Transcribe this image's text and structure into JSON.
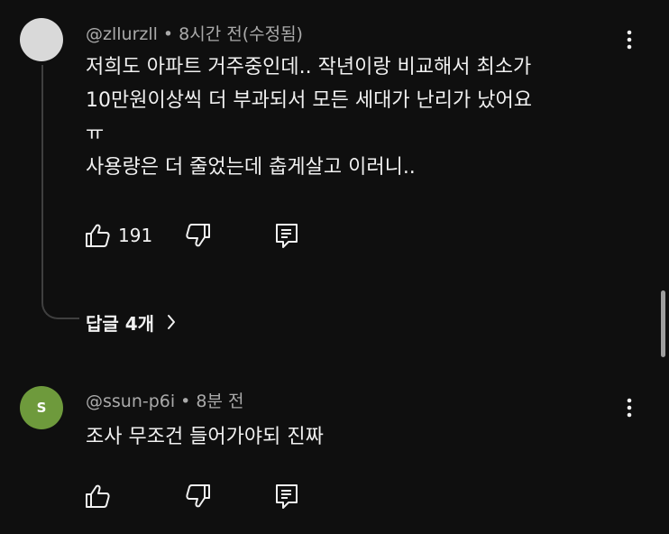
{
  "comments": [
    {
      "handle": "@zllurzll",
      "separator": "•",
      "time": "8시간 전(수정됨)",
      "avatar_color": "#d9d9d9",
      "avatar_letter": "",
      "lines": [
        "저희도 아파트 거주중인데.. 작년이랑 비교해서 최소가",
        "10만원이상씩 더 부과되서 모든 세대가 난리가 났어요",
        "ㅠ",
        "사용량은 더 줄었는데 춥게살고 이러니.."
      ],
      "like_count": "191",
      "replies_label": "답글 4개"
    },
    {
      "handle": "@ssun-p6i",
      "separator": "•",
      "time": "8분 전",
      "avatar_color": "#6e9a3c",
      "avatar_letter": "S",
      "lines": [
        "조사 무조건 들어가야되 진짜"
      ],
      "like_count": ""
    }
  ],
  "icons": {
    "like": "thumbs-up-icon",
    "dislike": "thumbs-down-icon",
    "reply": "reply-icon",
    "menu": "more-vertical-icon",
    "expand": "chevron-right-icon"
  },
  "colors": {
    "background": "#0f0f0f",
    "primary_text": "#f1f1f1",
    "secondary_text": "#aaaaaa",
    "thread_line": "#3f3f3f"
  }
}
